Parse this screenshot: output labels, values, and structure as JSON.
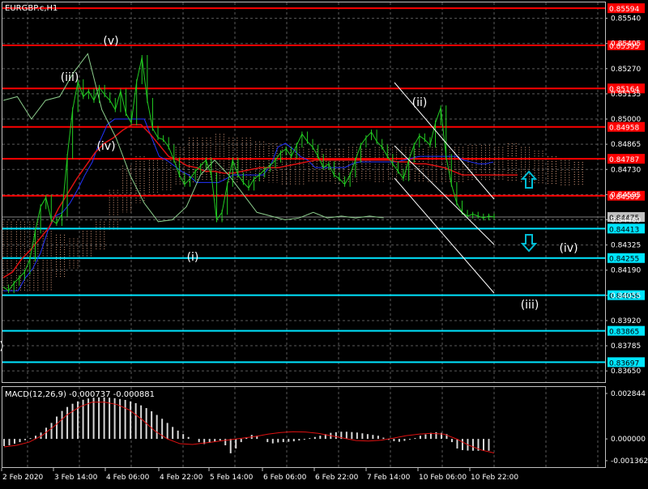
{
  "chart_data": [
    {
      "type": "line",
      "title": "EURGBP.c,H1",
      "symbol": "EURGBP.c",
      "timeframe": "H1",
      "x_labels": [
        "2 Feb 2020",
        "3 Feb 14:00",
        "4 Feb 06:00",
        "4 Feb 22:00",
        "5 Feb 14:00",
        "6 Feb 06:00",
        "6 Feb 22:00",
        "7 Feb 14:00",
        "10 Feb 06:00",
        "10 Feb 22:00"
      ],
      "y_ticks": [
        "0.85540",
        "0.85405",
        "0.85270",
        "0.85135",
        "0.85000",
        "0.84865",
        "0.84730",
        "0.84595",
        "0.84460",
        "0.84325",
        "0.84190",
        "0.84055",
        "0.83920",
        "0.83785",
        "0.83650"
      ],
      "ylim": [
        0.8359,
        0.85625
      ],
      "grid": true,
      "current_price": "0.84475",
      "price_series": {
        "name": "",
        "color": "#22cc22",
        "values": [
          0.841,
          0.8408,
          0.8412,
          0.8415,
          0.8418,
          0.8425,
          0.844,
          0.8453,
          0.8458,
          0.8446,
          0.8444,
          0.8449,
          0.848,
          0.8505,
          0.852,
          0.8512,
          0.8515,
          0.851,
          0.8517,
          0.8513,
          0.851,
          0.8505,
          0.8515,
          0.8503,
          0.8498,
          0.852,
          0.8533,
          0.851,
          0.8495,
          0.849,
          0.8489,
          0.8485,
          0.8478,
          0.847,
          0.8465,
          0.8468,
          0.8472,
          0.8475,
          0.8478,
          0.847,
          0.8446,
          0.845,
          0.8465,
          0.8478,
          0.847,
          0.8466,
          0.8463,
          0.8468,
          0.847,
          0.8473,
          0.8475,
          0.8478,
          0.8482,
          0.8484,
          0.848,
          0.8486,
          0.8492,
          0.8488,
          0.8485,
          0.848,
          0.8474,
          0.8476,
          0.847,
          0.8468,
          0.8465,
          0.847,
          0.8478,
          0.8486,
          0.849,
          0.8493,
          0.8488,
          0.8485,
          0.848,
          0.8476,
          0.8472,
          0.8468,
          0.8478,
          0.8486,
          0.8491,
          0.8489,
          0.8486,
          0.8498,
          0.8506,
          0.848,
          0.8465,
          0.8455,
          0.845,
          0.8448,
          0.8449,
          0.8448,
          0.8447,
          0.8448,
          0.84475
        ]
      },
      "lines": [
        {
          "name": "",
          "color": "#2233ff",
          "values": [
            0.8408,
            0.8408,
            0.8408,
            0.8415,
            0.842,
            0.8428,
            0.844,
            0.8448,
            0.845,
            0.8455,
            0.8462,
            0.847,
            0.8477,
            0.8488,
            0.8497,
            0.85,
            0.85,
            0.85,
            0.85,
            0.85,
            0.849,
            0.848,
            0.8478,
            0.8475,
            0.8472,
            0.847,
            0.8466,
            0.8466,
            0.8466,
            0.8466,
            0.8468,
            0.847,
            0.847,
            0.847,
            0.847,
            0.847,
            0.8475,
            0.8485,
            0.8487,
            0.8484,
            0.848,
            0.8478,
            0.8474,
            0.8474,
            0.8474,
            0.8474,
            0.8474,
            0.8476,
            0.8477,
            0.8477,
            0.8477,
            0.8477,
            0.8477,
            0.8477,
            0.8478,
            0.8479,
            0.848,
            0.848,
            0.848,
            0.848,
            0.848,
            0.848,
            0.8478,
            0.8477,
            0.8476,
            0.8476,
            0.8477
          ]
        },
        {
          "name": "",
          "color": "#dd1111",
          "values": [
            0.8415,
            0.8418,
            0.8425,
            0.843,
            0.8436,
            0.8442,
            0.8452,
            0.846,
            0.8468,
            0.8475,
            0.8482,
            0.8487,
            0.849,
            0.8494,
            0.8497,
            0.8497,
            0.8492,
            0.8486,
            0.848,
            0.8478,
            0.8475,
            0.8474,
            0.8472,
            0.8472,
            0.8471,
            0.8471,
            0.8472,
            0.8473,
            0.8474,
            0.8474,
            0.8474,
            0.8475,
            0.8476,
            0.8477,
            0.8478,
            0.8478,
            0.8478,
            0.8478,
            0.8478,
            0.8478,
            0.8478,
            0.8478,
            0.8478,
            0.8477,
            0.8477,
            0.8476,
            0.8476,
            0.8475,
            0.8474,
            0.8472,
            0.847,
            0.847,
            0.847,
            0.847,
            0.847,
            0.847,
            0.847
          ]
        },
        {
          "name": "",
          "color": "#8ccd8c",
          "values": [
            0.851,
            0.8512,
            0.85,
            0.851,
            0.8512,
            0.8525,
            0.8535,
            0.8505,
            0.849,
            0.847,
            0.8455,
            0.8445,
            0.8446,
            0.8453,
            0.847,
            0.8478,
            0.847,
            0.846,
            0.845,
            0.8448,
            0.8446,
            0.8447,
            0.845,
            0.8447,
            0.8448,
            0.8447,
            0.8448,
            0.8447
          ]
        }
      ],
      "cloud": {
        "name": "",
        "upper": [
          0.8445,
          0.8445,
          0.8445,
          0.844,
          0.8438,
          0.8436,
          0.844,
          0.8445,
          0.8462,
          0.8475,
          0.848,
          0.8478,
          0.8478,
          0.8485,
          0.849,
          0.849,
          0.8492,
          0.849,
          0.849,
          0.8488,
          0.8487,
          0.8485,
          0.8485,
          0.8484,
          0.8484,
          0.8484,
          0.8485,
          0.8484,
          0.8485,
          0.8485,
          0.8485,
          0.8484,
          0.8485,
          0.8485,
          0.8485,
          0.8486,
          0.8486,
          0.8485,
          0.8487,
          0.8485,
          0.8483,
          0.848,
          0.8478,
          0.8477,
          0.8477
        ],
        "lower": [
          0.8408,
          0.8408,
          0.8408,
          0.8408,
          0.8415,
          0.842,
          0.8425,
          0.843,
          0.844,
          0.845,
          0.8455,
          0.846,
          0.8462,
          0.8465,
          0.8466,
          0.8467,
          0.8467,
          0.8466,
          0.8467,
          0.8466,
          0.8466,
          0.8465,
          0.8465,
          0.8466,
          0.8466,
          0.8465,
          0.8466,
          0.8467,
          0.8466,
          0.8467,
          0.8467,
          0.8466,
          0.8466,
          0.8466,
          0.8466,
          0.8467,
          0.8467,
          0.8467,
          0.8467,
          0.8466,
          0.8465,
          0.8465,
          0.8464,
          0.8464,
          0.8464
        ]
      },
      "channel_lines": [
        {
          "name": "",
          "color": "#ffffff",
          "start": 0.852,
          "end": 0.8464
        },
        {
          "name": "",
          "color": "#ffffff",
          "start": 0.849,
          "end": 0.842
        }
      ],
      "horizontal_levels": [
        {
          "label": "0.85594",
          "value": 0.85594,
          "color": "#ff0000"
        },
        {
          "label": "0.85395",
          "value": 0.85395,
          "color": "#ff0000"
        },
        {
          "label": "0.85164",
          "value": 0.85164,
          "color": "#ff0000"
        },
        {
          "label": "0.84958",
          "value": 0.84958,
          "color": "#ff0000"
        },
        {
          "label": "0.84787",
          "value": 0.84787,
          "color": "#ff0000"
        },
        {
          "label": "0.84589",
          "value": 0.84589,
          "color": "#ff0000"
        },
        {
          "label": "0.84413",
          "value": 0.84413,
          "color": "#00e5ff"
        },
        {
          "label": "0.84255",
          "value": 0.84255,
          "color": "#00e5ff"
        },
        {
          "label": "0.84056",
          "value": 0.84056,
          "color": "#00e5ff"
        },
        {
          "label": "0.83865",
          "value": 0.83865,
          "color": "#00e5ff"
        },
        {
          "label": "0.83697",
          "value": 0.83697,
          "color": "#00e5ff"
        }
      ],
      "wave_labels": [
        "(v)",
        "(iii)",
        "(iv)",
        "(i)",
        "(ii)",
        "(iv)",
        "(iii)",
        ")"
      ],
      "arrows": [
        {
          "direction": "up",
          "name": "up-arrow-icon",
          "color": "#00bcd4"
        },
        {
          "direction": "down",
          "name": "down-arrow-icon",
          "color": "#00bcd4"
        }
      ]
    },
    {
      "type": "bar",
      "title": "MACD(12,26,9) -0.000737 -0.000881",
      "y_ticks": [
        "0.002844",
        "0.000000",
        "-0.001362"
      ],
      "ylim": [
        -0.001362,
        0.002844
      ],
      "series": [
        {
          "name": "",
          "color": "#d8d8d8",
          "values": [
            -0.00045,
            -0.0004,
            -0.0003,
            -0.0002,
            -8e-05,
            5e-05,
            0.0002,
            0.0004,
            0.0007,
            0.001,
            0.0014,
            0.00175,
            0.002,
            0.0022,
            0.00235,
            0.00245,
            0.00253,
            0.00258,
            0.0026,
            0.0026,
            0.00258,
            0.00255,
            0.0025,
            0.00244,
            0.00235,
            0.00224,
            0.0021,
            0.00193,
            0.00173,
            0.0015,
            0.00126,
            0.001,
            0.00075,
            0.00052,
            0.0003,
            0.00012,
            0.0,
            -0.0002,
            -0.00032,
            -0.00025,
            -0.00018,
            -0.0001,
            -0.0004,
            -0.0009,
            -0.0006,
            -0.0002,
            0.0001,
            0.00025,
            0.0002,
            0.0,
            -0.0002,
            -0.00028,
            -0.00022,
            -0.0002,
            -0.00018,
            -0.00015,
            -0.0001,
            -5e-05,
            5e-05,
            0.00012,
            0.0002,
            0.0003,
            0.00038,
            0.00042,
            0.00045,
            0.00045,
            0.00043,
            0.0004,
            0.00035,
            0.0003,
            0.00025,
            0.0002,
            8e-05,
            -6e-05,
            -0.00014,
            -0.00018,
            -0.00012,
            -5e-05,
            5e-05,
            0.0002,
            0.00028,
            0.00038,
            0.00042,
            0.00038,
            0.0003,
            -0.0002,
            -0.0006,
            -0.0007,
            -0.00073,
            -0.00074,
            -0.00074,
            -0.00074,
            -0.00074
          ]
        },
        {
          "name": "",
          "color": "#dd1111",
          "type": "line",
          "values": [
            -0.0005,
            -0.0004,
            -0.0002,
            0.0002,
            0.0008,
            0.0015,
            0.002,
            0.0023,
            0.0023,
            0.00215,
            0.0018,
            0.0012,
            0.0005,
            0.0,
            -0.0003,
            -0.00035,
            -0.00025,
            -0.00015,
            -5e-05,
            5e-05,
            0.00015,
            0.0003,
            0.0004,
            0.00045,
            0.00043,
            0.00035,
            0.0002,
            5e-05,
            -0.0001,
            -0.00013,
            -8e-05,
            5e-05,
            0.0002,
            0.0003,
            0.00035,
            0.0003,
            0.0,
            -0.0004,
            -0.0007,
            -0.00088
          ]
        }
      ]
    }
  ]
}
